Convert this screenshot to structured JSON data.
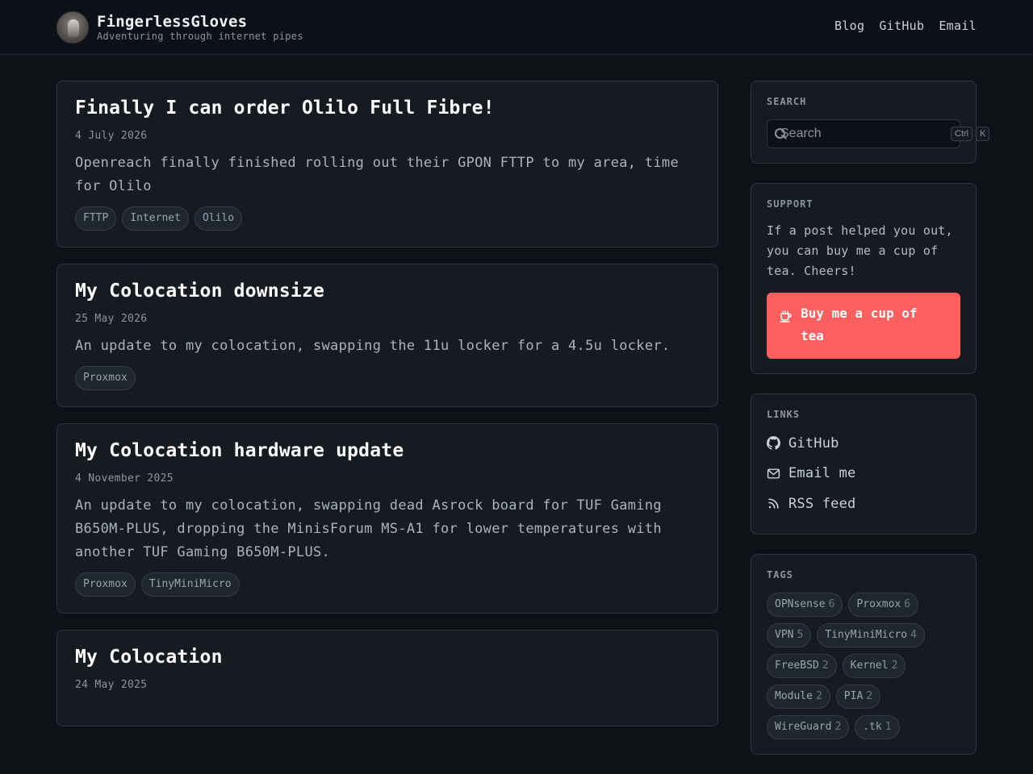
{
  "header": {
    "site_title": "FingerlessGloves",
    "tagline": "Adventuring through internet pipes",
    "nav": [
      "Blog",
      "GitHub",
      "Email"
    ]
  },
  "posts": [
    {
      "title": "Finally I can order Olilo Full Fibre!",
      "date": "4 July 2026",
      "summary": "Openreach finally finished rolling out their GPON FTTP to my area, time for Olilo",
      "tags": [
        "FTTP",
        "Internet",
        "Olilo"
      ]
    },
    {
      "title": "My Colocation downsize",
      "date": "25 May 2026",
      "summary": "An update to my colocation, swapping the 11u locker for a 4.5u locker.",
      "tags": [
        "Proxmox"
      ]
    },
    {
      "title": "My Colocation hardware update",
      "date": "4 November 2025",
      "summary": "An update to my colocation, swapping dead Asrock board for TUF Gaming B650M-PLUS, dropping the MinisForum MS-A1 for lower temperatures with another TUF Gaming B650M-PLUS.",
      "tags": [
        "Proxmox",
        "TinyMiniMicro"
      ]
    },
    {
      "title": "My Colocation",
      "date": "24 May 2025",
      "summary": "",
      "tags": []
    }
  ],
  "sidebar": {
    "search": {
      "heading": "SEARCH",
      "placeholder": "Search",
      "shortcut": [
        "Ctrl",
        "K"
      ]
    },
    "support": {
      "heading": "SUPPORT",
      "text": "If a post helped you out, you can buy me a cup of tea. Cheers!",
      "button_label": "Buy me a cup of tea"
    },
    "links": {
      "heading": "LINKS",
      "items": [
        {
          "label": "GitHub",
          "icon": "github-icon"
        },
        {
          "label": "Email me",
          "icon": "mail-icon"
        },
        {
          "label": "RSS feed",
          "icon": "rss-icon"
        }
      ]
    },
    "tags": {
      "heading": "TAGS",
      "items": [
        {
          "name": "OPNsense",
          "count": "6"
        },
        {
          "name": "Proxmox",
          "count": "6"
        },
        {
          "name": "VPN",
          "count": "5"
        },
        {
          "name": "TinyMiniMicro",
          "count": "4"
        },
        {
          "name": "FreeBSD",
          "count": "2"
        },
        {
          "name": "Kernel",
          "count": "2"
        },
        {
          "name": "Module",
          "count": "2"
        },
        {
          "name": "PIA",
          "count": "2"
        },
        {
          "name": "WireGuard",
          "count": "2"
        },
        {
          "name": ".tk",
          "count": "1"
        }
      ]
    }
  },
  "colors": {
    "background": "#0e1116",
    "card": "#161b22",
    "border": "#30363d",
    "accent_button": "#ff5f5f"
  }
}
